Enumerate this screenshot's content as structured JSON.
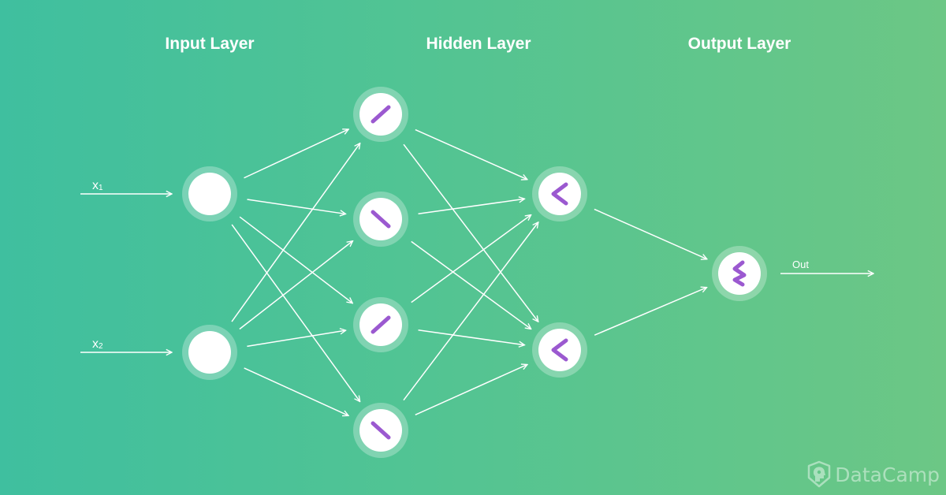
{
  "layers": {
    "input": {
      "title": "Input Layer"
    },
    "hidden": {
      "title": "Hidden Layer"
    },
    "output": {
      "title": "Output Layer"
    }
  },
  "inputs": [
    {
      "label": "x",
      "sub": "1"
    },
    {
      "label": "x",
      "sub": "2"
    }
  ],
  "output_label": "Out",
  "nodes": {
    "input": [
      {
        "id": "i1",
        "icon": "none"
      },
      {
        "id": "i2",
        "icon": "none"
      }
    ],
    "hidden": [
      {
        "id": "h1",
        "icon": "forward-slash-icon"
      },
      {
        "id": "h2",
        "icon": "backslash-icon"
      },
      {
        "id": "h3",
        "icon": "forward-slash-icon"
      },
      {
        "id": "h4",
        "icon": "backslash-icon"
      }
    ],
    "hidden2": [
      {
        "id": "g1",
        "icon": "less-than-icon"
      },
      {
        "id": "g2",
        "icon": "less-than-icon"
      }
    ],
    "output": [
      {
        "id": "o1",
        "icon": "zigzag-icon"
      }
    ]
  },
  "connections": [
    [
      "i1",
      "h1"
    ],
    [
      "i1",
      "h2"
    ],
    [
      "i1",
      "h3"
    ],
    [
      "i1",
      "h4"
    ],
    [
      "i2",
      "h1"
    ],
    [
      "i2",
      "h2"
    ],
    [
      "i2",
      "h3"
    ],
    [
      "i2",
      "h4"
    ],
    [
      "h1",
      "g1"
    ],
    [
      "h1",
      "g2"
    ],
    [
      "h2",
      "g1"
    ],
    [
      "h2",
      "g2"
    ],
    [
      "h3",
      "g1"
    ],
    [
      "h3",
      "g2"
    ],
    [
      "h4",
      "g1"
    ],
    [
      "h4",
      "g2"
    ],
    [
      "g1",
      "o1"
    ],
    [
      "g2",
      "o1"
    ]
  ],
  "colors": {
    "icon_stroke": "#9b59d0",
    "node_fill": "#ffffff",
    "arrow": "#ffffff"
  },
  "brand": {
    "name": "DataCamp",
    "icon": "datacamp-logo-icon"
  }
}
